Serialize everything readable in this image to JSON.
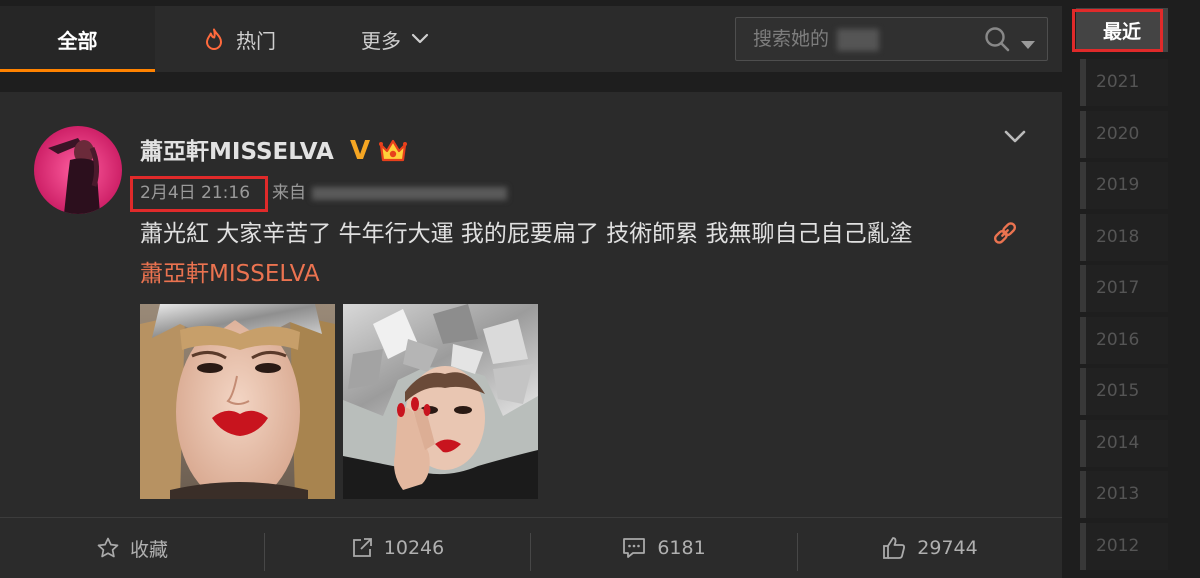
{
  "tabs": [
    {
      "label": "全部"
    },
    {
      "label": "热门",
      "icon": "flame-icon"
    },
    {
      "label": "更多",
      "icon": "chevron-down-icon"
    }
  ],
  "search": {
    "placeholder": "搜索她的",
    "icons": [
      "search-icon",
      "dropdown-arrow-icon"
    ]
  },
  "timeline": {
    "recent_label": "最近",
    "years": [
      "2021",
      "2020",
      "2019",
      "2018",
      "2017",
      "2016",
      "2015",
      "2014",
      "2013",
      "2012"
    ]
  },
  "post": {
    "author": "蕭亞軒MISSELVA",
    "verified_badge": "V",
    "badges": [
      "verified-v-icon",
      "crown-icon"
    ],
    "timestamp": "2月4日 21:16",
    "source_prefix": "来自",
    "text": "蕭光紅 大家辛苦了 牛年行大運 我的屁要扁了 技術師累 我無聊自己自己亂塗",
    "mention": "蕭亞軒MISSELVA",
    "actions": {
      "favorite_label": "收藏",
      "repost_count": "10246",
      "comment_count": "6181",
      "like_count": "29744"
    }
  },
  "colors": {
    "accent": "#ff8200",
    "link": "#eb7350",
    "verified": "#f5a623",
    "annotation_highlight": "#e02a2a"
  }
}
